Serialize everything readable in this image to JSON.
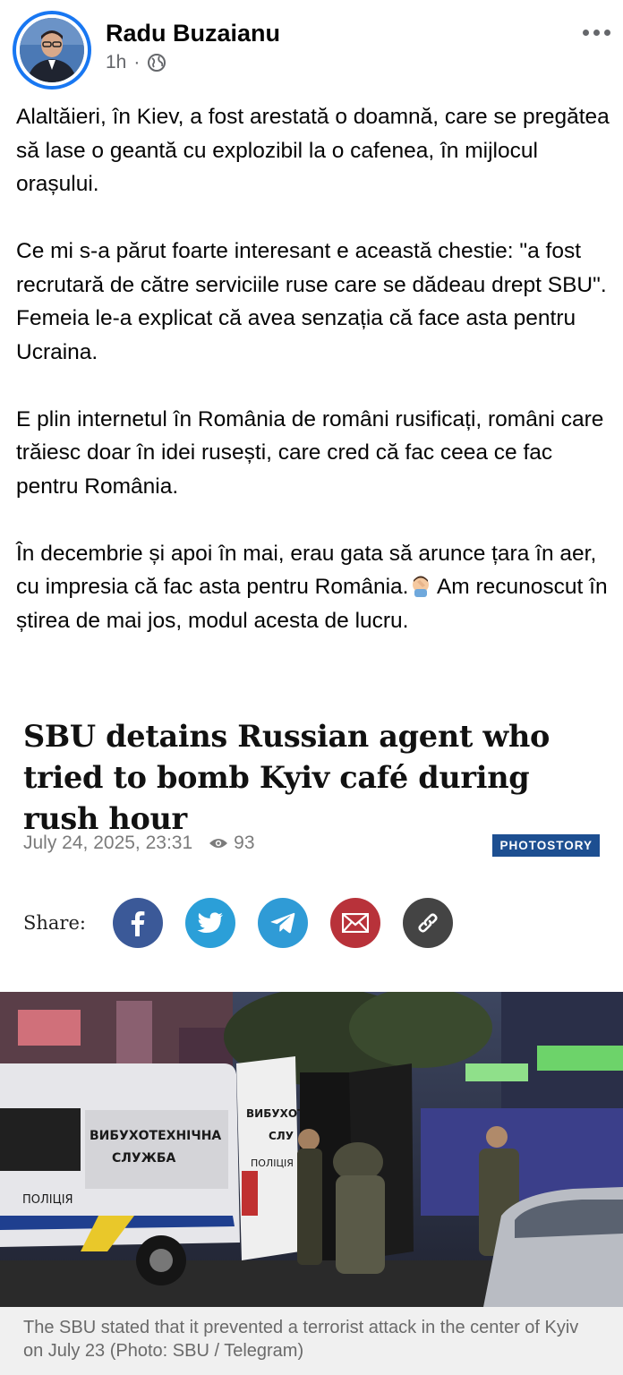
{
  "post": {
    "author": "Radu Buzaianu",
    "time": "1h",
    "separator": "·",
    "audience_icon": "globe-icon",
    "more_icon": "more-options-icon",
    "paragraphs": [
      "Alaltăieri, în Kiev, a fost arestată o doamnă, care se pregătea să lase o geantă cu explozibil la o cafenea, în mijlocul orașului.",
      "Ce mi s-a părut foarte interesant e această chestie: \"a fost recrutară de către serviciile ruse care se dădeau drept SBU\". Femeia le-a explicat că avea senzația că face asta pentru Ucraina.",
      "E plin internetul în România de români rusificați, români care trăiesc doar în idei rusești, care cred că fac ceea ce fac pentru România."
    ],
    "last_paragraph_before_emoji": "În decembrie și apoi în mai, erau gata să arunce țara în aer, cu impresia că fac asta pentru România.",
    "last_paragraph_after_emoji": " Am recunoscut în știrea de mai jos, modul acesta de lucru.",
    "emoji": "facepalm-emoji"
  },
  "article": {
    "headline": "SBU detains Russian agent who tried to bomb Kyiv café during rush hour",
    "date": "July 24, 2025, 23:31",
    "views": "93",
    "badge": "PHOTOSTORY",
    "share_label": "Share:",
    "share_buttons": [
      {
        "icon": "facebook-icon",
        "color": "#3b5998"
      },
      {
        "icon": "twitter-icon",
        "color": "#2b9fd8"
      },
      {
        "icon": "telegram-icon",
        "color": "#2f9bd6"
      },
      {
        "icon": "email-icon",
        "color": "#b8323a"
      },
      {
        "icon": "link-icon",
        "color": "#444444"
      }
    ],
    "photo_van_text_1": "ВИБУХОТЕХНІЧНА",
    "photo_van_text_2": "СЛУЖБА",
    "photo_van_police": "ПОЛІЦІЯ",
    "photo_van_door_1": "ВИБУХОТ",
    "photo_van_door_2": "СЛУ",
    "photo_van_door_3": "ПОЛІЦІЯ",
    "caption": "The SBU stated that it prevented a terrorist attack in the center of Kyiv on July 23 (Photo: SBU / Telegram)"
  }
}
